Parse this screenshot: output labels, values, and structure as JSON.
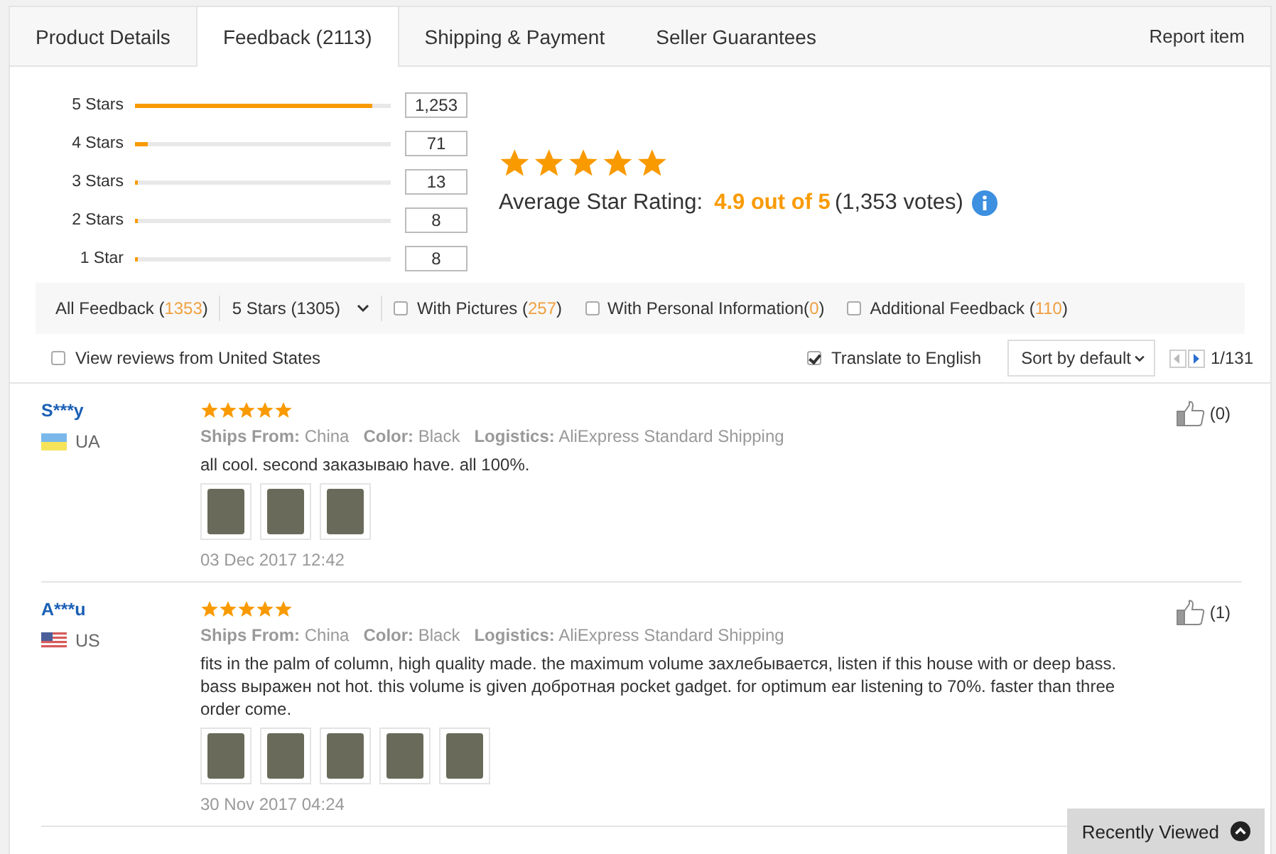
{
  "tabs": [
    {
      "label": "Product Details",
      "selected": false
    },
    {
      "label": "Feedback (2113)",
      "selected": true
    },
    {
      "label": "Shipping & Payment",
      "selected": false
    },
    {
      "label": "Seller Guarantees",
      "selected": false
    }
  ],
  "report_link": "Report item",
  "breakdown": [
    {
      "label": "5 Stars",
      "level": 0.93,
      "count": "1,253"
    },
    {
      "label": "4 Stars",
      "level": 0.05,
      "count": "71"
    },
    {
      "label": "3 Stars",
      "level": 0.01,
      "count": "13"
    },
    {
      "label": "2 Stars",
      "level": 0.01,
      "count": "8"
    },
    {
      "label": "1 Star",
      "level": 0.01,
      "count": "8"
    }
  ],
  "summary": {
    "stars": 5,
    "label": "Average Star Rating:",
    "score": "4.9 out of 5",
    "votes": "(1,353 votes)"
  },
  "filters": [
    {
      "kind": "link",
      "prefix": "All Feedback (",
      "count": "1353",
      "suffix": ")"
    },
    {
      "kind": "dropdown",
      "prefix": "5 Stars (1305)"
    },
    {
      "kind": "checkbox",
      "checked": false,
      "prefix": "With Pictures (",
      "count": "257",
      "suffix": ")"
    },
    {
      "kind": "checkbox",
      "checked": false,
      "prefix": "With Personal Information(",
      "count": "0",
      "suffix": ")"
    },
    {
      "kind": "checkbox",
      "checked": false,
      "prefix": "Additional Feedback (",
      "count": "110",
      "suffix": ")"
    }
  ],
  "view_us": {
    "label": "View reviews from United States",
    "checked": false
  },
  "translate": {
    "label": "Translate to English",
    "checked": true
  },
  "sort": "Sort by default",
  "page": "1/131",
  "reviews": [
    {
      "name": "S***y",
      "flag": {
        "kind": "ua"
      },
      "country": "UA",
      "stars": 5,
      "details": [
        {
          "label": "Ships From:",
          "value": "China"
        },
        {
          "label": "Color:",
          "value": "Black"
        },
        {
          "label": "Logistics:",
          "value": "AliExpress Standard Shipping"
        }
      ],
      "text": "all cool. second заказываю have. all 100%.",
      "photos": [
        {
          "kind": "photo"
        },
        {
          "kind": "photo"
        },
        {
          "kind": "photo"
        }
      ],
      "likes": "(0)",
      "date": "03 Dec 2017 12:42"
    },
    {
      "name": "A***u",
      "flag": {
        "kind": "us"
      },
      "country": "US",
      "stars": 5,
      "details": [
        {
          "label": "Ships From:",
          "value": "China"
        },
        {
          "label": "Color:",
          "value": "Black"
        },
        {
          "label": "Logistics:",
          "value": "AliExpress Standard Shipping"
        }
      ],
      "text": "fits in the palm of column, high quality made. the maximum volume захлебывается, listen if this house with or deep bass. bass выражен not hot. this volume is given добротная pocket gadget. for optimum ear listening to 70%. faster than three order come.",
      "photos": [
        {
          "kind": "photo"
        },
        {
          "kind": "photo"
        },
        {
          "kind": "photo"
        },
        {
          "kind": "photo"
        },
        {
          "kind": "photo"
        }
      ],
      "likes": "(1)",
      "date": "30 Nov 2017 04:24"
    }
  ],
  "recently_viewed": "Recently Viewed"
}
